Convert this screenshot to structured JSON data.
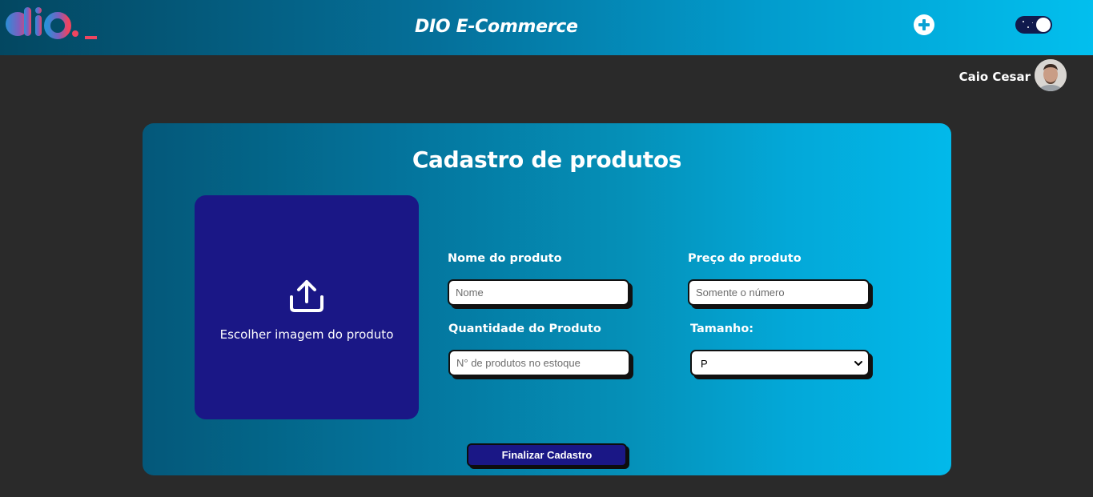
{
  "header": {
    "title": "DIO E-Commerce",
    "add_icon": "plus-circle-icon",
    "theme_toggle_state": "dark"
  },
  "user": {
    "name": "Caio Cesar"
  },
  "form": {
    "title": "Cadastro de produtos",
    "upload": {
      "icon": "upload-icon",
      "label": "Escolher imagem do produto"
    },
    "fields": {
      "name": {
        "label": "Nome do produto",
        "placeholder": "Nome",
        "value": ""
      },
      "price": {
        "label": "Preço do produto",
        "placeholder": "Somente o número",
        "value": ""
      },
      "quantity": {
        "label": "Quantidade do Produto",
        "placeholder": "N° de produtos no estoque",
        "value": ""
      },
      "size": {
        "label": "Tamanho:",
        "selected": "P"
      }
    },
    "submit_label": "Finalizar Cadastro"
  },
  "colors": {
    "background": "#2a2a2a",
    "header_gradient_start": "#034761",
    "header_gradient_end": "#02bfee",
    "upload_box": "#1a1786",
    "button": "#1a1786",
    "logo_pink": "#e8456b",
    "logo_blue": "#3b8fd6"
  }
}
